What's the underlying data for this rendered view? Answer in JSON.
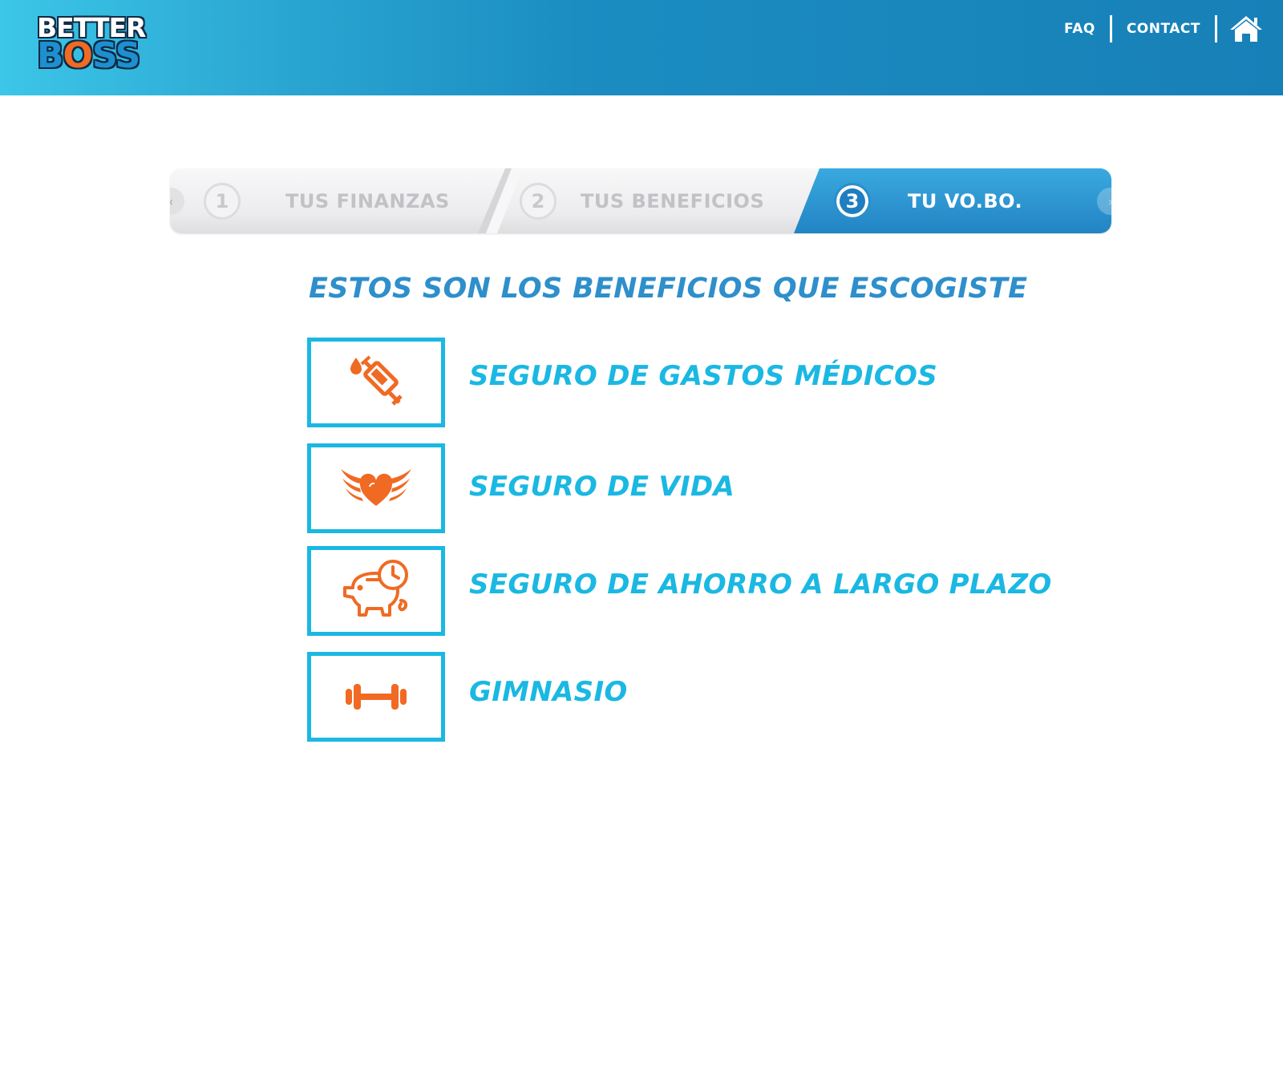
{
  "brand": {
    "line1": "BETTER",
    "line2_b": "B",
    "line2_o": "O",
    "line2_ss": "SS"
  },
  "nav": {
    "faq": "FAQ",
    "contact": "CONTACT",
    "home_icon": "home-icon"
  },
  "stepper": {
    "prev_arrow": "‹",
    "next_arrow": "›",
    "steps": [
      {
        "number": "1",
        "label": "TUS FINANZAS",
        "state": "inactive"
      },
      {
        "number": "2",
        "label": "TUS BENEFICIOS",
        "state": "inactive"
      },
      {
        "number": "3",
        "label": "TU VO.BO.",
        "state": "active"
      }
    ]
  },
  "main": {
    "heading": "ESTOS SON LOS BENEFICIOS QUE ESCOGISTE",
    "benefits": [
      {
        "label": "SEGURO DE GASTOS MÉDICOS",
        "icon": "syringe-icon"
      },
      {
        "label": "SEGURO DE VIDA",
        "icon": "winged-heart-icon"
      },
      {
        "label": "SEGURO DE AHORRO A LARGO PLAZO",
        "icon": "piggy-bank-clock-icon"
      },
      {
        "label": "GIMNASIO",
        "icon": "dumbbell-icon"
      }
    ]
  },
  "colors": {
    "header_start": "#3cc6e8",
    "header_end": "#1780b7",
    "accent_blue": "#1ab8e2",
    "heading_blue": "#2e8fcb",
    "icon_orange": "#f06a23",
    "logo_navy": "#0f2a44"
  }
}
